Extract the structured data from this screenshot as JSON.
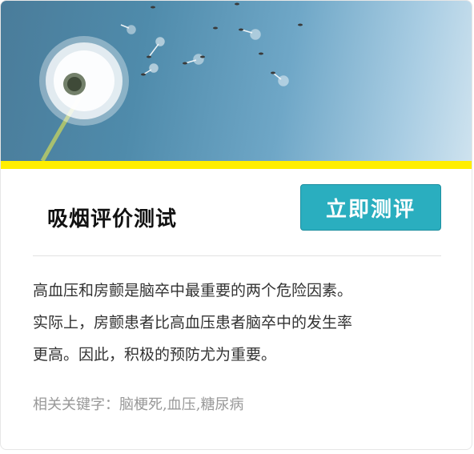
{
  "card": {
    "title": "吸烟评价测试",
    "cta_label": "立即测评",
    "description_lines": [
      "高血压和房颤是脑卒中最重要的两个危险因素。",
      "实际上，房颤患者比高血压患者脑卒中的发生率",
      "更高。因此，积极的预防尤为重要。"
    ],
    "keywords_label": "相关关键字：",
    "keywords": "脑梗死,血压,糖尿病"
  },
  "colors": {
    "accent_bar": "#ffee00",
    "cta_background": "#2aaebf",
    "title_text": "#111111",
    "body_text": "#333333",
    "muted_text": "#999999"
  },
  "icons": {
    "hero_image": "dandelion-photo"
  }
}
